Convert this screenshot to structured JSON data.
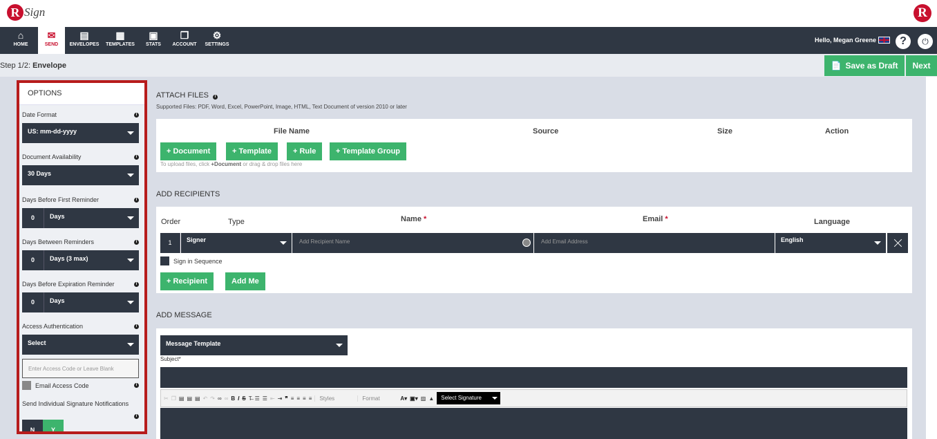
{
  "brand": {
    "logo_letter": "R",
    "logo_text": "Sign",
    "right_logo_letter": "R"
  },
  "nav": {
    "items": [
      {
        "label": "HOME",
        "icon": "home-icon",
        "glyph": "⌂"
      },
      {
        "label": "SEND",
        "icon": "envelope-icon",
        "glyph": "✉"
      },
      {
        "label": "ENVELOPES",
        "icon": "inbox-icon",
        "glyph": "▤"
      },
      {
        "label": "TEMPLATES",
        "icon": "template-icon",
        "glyph": "▦"
      },
      {
        "label": "STATS",
        "icon": "briefcase-icon",
        "glyph": "▣"
      },
      {
        "label": "ACCOUNT",
        "icon": "document-icon",
        "glyph": "❐"
      },
      {
        "label": "SETTINGS",
        "icon": "gear-icon",
        "glyph": "⚙"
      }
    ],
    "active": "SEND",
    "greeting": "Hello, Megan Greene",
    "help": "?",
    "power": "⏻"
  },
  "step": {
    "prefix": "Step 1/2: ",
    "name": "Envelope",
    "save_draft": "Save as Draft",
    "next": "Next"
  },
  "options": {
    "title": "OPTIONS",
    "date_format": {
      "label": "Date Format",
      "value": "US: mm-dd-yyyy"
    },
    "availability": {
      "label": "Document Availability",
      "value": "30 Days"
    },
    "first_reminder": {
      "label": "Days Before First Reminder",
      "number": "0",
      "value": "Days"
    },
    "between_reminders": {
      "label": "Days Between Reminders",
      "number": "0",
      "value": "Days (3 max)"
    },
    "expiration_reminder": {
      "label": "Days Before Expiration Reminder",
      "number": "0",
      "value": "Days"
    },
    "access_auth": {
      "label": "Access Authentication",
      "value": "Select"
    },
    "access_code_placeholder": "Enter Access Code or Leave Blank",
    "email_access_code": "Email Access Code",
    "individual_notifications": {
      "label": "Send Individual Signature Notifications",
      "no": "N",
      "yes": "Y"
    }
  },
  "attach": {
    "title": "ATTACH FILES",
    "supported": "Supported Files: PDF, Word, Excel, PowerPoint, Image, HTML, Text Document of version 2010 or later",
    "headers": {
      "file_name": "File Name",
      "source": "Source",
      "size": "Size",
      "action": "Action"
    },
    "buttons": {
      "document": "+ Document",
      "template": "+ Template",
      "rule": "+ Rule",
      "template_group": "+ Template Group"
    },
    "note_pre": "To upload files, click ",
    "note_bold": "+Document",
    "note_post": " or drag & drop files here"
  },
  "recipients": {
    "title": "ADD RECIPIENTS",
    "headers": {
      "order": "Order",
      "type": "Type",
      "name": "Name",
      "email": "Email",
      "language": "Language",
      "required": "*"
    },
    "row": {
      "order": "1",
      "type": "Signer",
      "name_placeholder": "Add Recipient Name",
      "email_placeholder": "Add Email Address",
      "language": "English"
    },
    "sign_in_sequence": "Sign in Sequence",
    "add_recipient": "+ Recipient",
    "add_me": "Add Me"
  },
  "message": {
    "title": "ADD MESSAGE",
    "template": "Message Template",
    "subject_label": "Subject*",
    "toolbar": {
      "styles": "Styles",
      "format": "Format",
      "signature": "Select Signature"
    }
  }
}
